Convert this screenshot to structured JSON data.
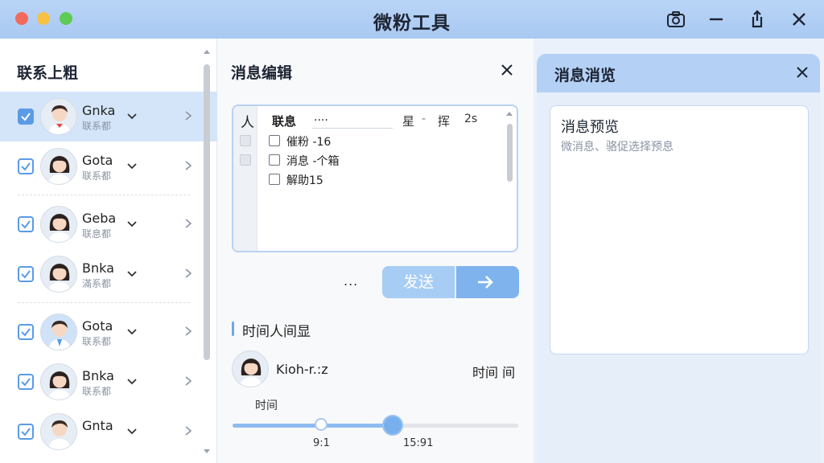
{
  "window": {
    "title": "微粉工具",
    "accent": "#5b9be6"
  },
  "titlebar": {
    "icons": [
      "camera-icon",
      "minimize-icon",
      "share-icon",
      "close-icon"
    ]
  },
  "contacts": {
    "title": "联系上粗",
    "items": [
      {
        "name": "Gnka",
        "sub": "联系都",
        "checked": true,
        "selected": true
      },
      {
        "name": "Gota",
        "sub": "联系都",
        "checked": true,
        "selected": false
      },
      {
        "name": "Geba",
        "sub": "联息都",
        "checked": true,
        "selected": false
      },
      {
        "name": "Bnka",
        "sub": "滿系都",
        "checked": true,
        "selected": false
      },
      {
        "name": "Gota",
        "sub": "联系都",
        "checked": true,
        "selected": false
      },
      {
        "name": "Bnka",
        "sub": "联系都",
        "checked": true,
        "selected": false
      },
      {
        "name": "Gnta",
        "sub": "",
        "checked": true,
        "selected": false
      }
    ]
  },
  "editor": {
    "title": "消息编辑",
    "header": {
      "person": "人",
      "contact": "联息",
      "input_value": "....",
      "star": "星",
      "dash": "-",
      "lang": "挥",
      "num": "2s"
    },
    "items": [
      {
        "text": "催粉 -16",
        "checked": false
      },
      {
        "text": "消息 -个箱",
        "checked": false
      },
      {
        "text": "解助15",
        "checked": false
      }
    ],
    "more": "...",
    "send_label": "发送",
    "section_title": "时间人间显",
    "person_name": "Kioh-r.:z",
    "person_time": "时间 间",
    "slider_label": "时间",
    "slider": {
      "min_label": "9:1",
      "max_label": "15:91",
      "small_knob": 0.31,
      "big_knob": 0.56
    }
  },
  "preview": {
    "title": "消息消览",
    "body_title": "消息预览",
    "body_hint": "微消息、骆促选择预息"
  }
}
